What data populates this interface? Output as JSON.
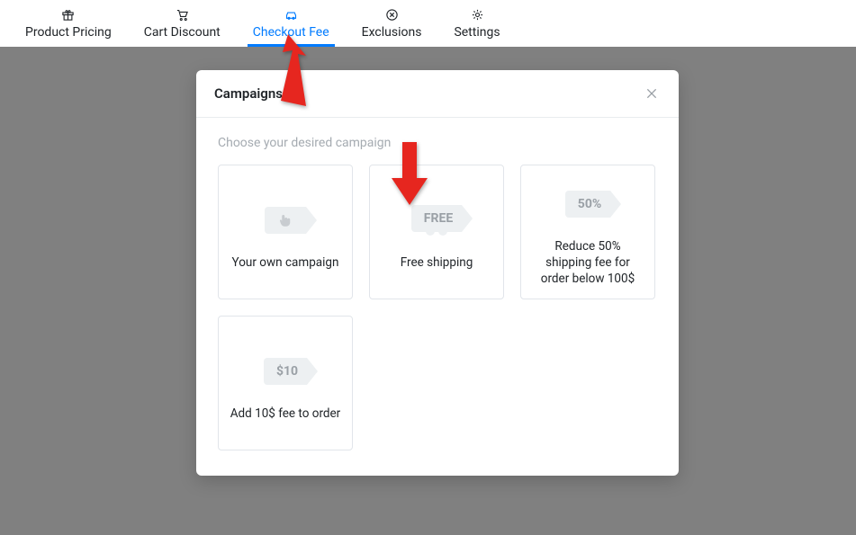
{
  "tabs": [
    {
      "label": "Product Pricing"
    },
    {
      "label": "Cart Discount"
    },
    {
      "label": "Checkout Fee"
    },
    {
      "label": "Exclusions"
    },
    {
      "label": "Settings"
    }
  ],
  "modal": {
    "title": "Campaigns",
    "subtitle": "Choose your desired campaign",
    "cards": [
      {
        "badge": "",
        "label": "Your own campaign"
      },
      {
        "badge": "FREE",
        "label": "Free shipping"
      },
      {
        "badge": "50%",
        "label": "Reduce 50% shipping fee for order below 100$"
      },
      {
        "badge": "$10",
        "label": "Add 10$ fee to order"
      }
    ]
  }
}
